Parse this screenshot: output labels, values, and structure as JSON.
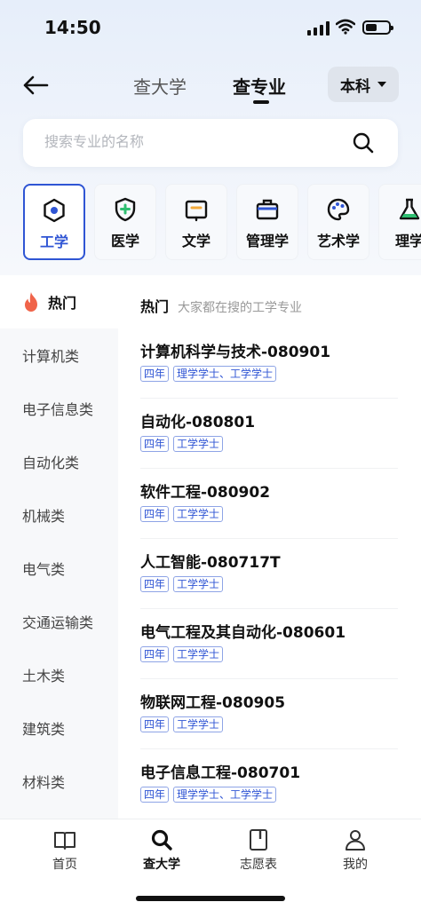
{
  "status": {
    "time": "14:50"
  },
  "nav": {
    "tabs": [
      "查大学",
      "查专业"
    ],
    "active_tab": 1,
    "degree": "本科"
  },
  "search": {
    "placeholder": "搜索专业的名称"
  },
  "categories": [
    "工学",
    "医学",
    "文学",
    "管理学",
    "艺术学",
    "理学"
  ],
  "sidebar": {
    "hot_label": "热门",
    "items": [
      "计算机类",
      "电子信息类",
      "自动化类",
      "机械类",
      "电气类",
      "交通运输类",
      "土木类",
      "建筑类",
      "材料类"
    ]
  },
  "section": {
    "title": "热门",
    "subtitle": "大家都在搜的工学专业"
  },
  "majors": [
    {
      "name": "计算机科学与技术-080901",
      "tags": [
        "四年",
        "理学学士、工学学士"
      ]
    },
    {
      "name": "自动化-080801",
      "tags": [
        "四年",
        "工学学士"
      ]
    },
    {
      "name": "软件工程-080902",
      "tags": [
        "四年",
        "工学学士"
      ]
    },
    {
      "name": "人工智能-080717T",
      "tags": [
        "四年",
        "工学学士"
      ]
    },
    {
      "name": "电气工程及其自动化-080601",
      "tags": [
        "四年",
        "工学学士"
      ]
    },
    {
      "name": "物联网工程-080905",
      "tags": [
        "四年",
        "工学学士"
      ]
    },
    {
      "name": "电子信息工程-080701",
      "tags": [
        "四年",
        "理学学士、工学学士"
      ]
    }
  ],
  "bottom_nav": [
    "首页",
    "查大学",
    "志愿表",
    "我的"
  ],
  "colors": {
    "accent": "#2f55d4",
    "hot": "#f0644a",
    "medical": "#2fbf71",
    "literature": "#f2a93b",
    "science": "#2fbf71"
  }
}
